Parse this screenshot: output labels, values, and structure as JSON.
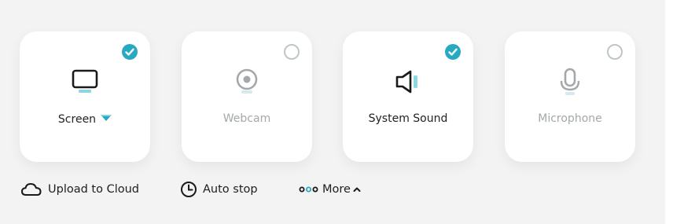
{
  "sources": [
    {
      "label": "Screen",
      "selected": true,
      "icon": "monitor-icon",
      "has_dropdown": true
    },
    {
      "label": "Webcam",
      "selected": false,
      "icon": "webcam-icon",
      "has_dropdown": false
    },
    {
      "label": "System Sound",
      "selected": true,
      "icon": "speaker-icon",
      "has_dropdown": false
    },
    {
      "label": "Microphone",
      "selected": false,
      "icon": "microphone-icon",
      "has_dropdown": false
    }
  ],
  "options": {
    "upload_label": "Upload to Cloud",
    "autostop_label": "Auto stop",
    "more_label": "More"
  },
  "colors": {
    "accent": "#27aac1",
    "inactive": "#a4a8aa",
    "background": "#f3f3f3"
  }
}
